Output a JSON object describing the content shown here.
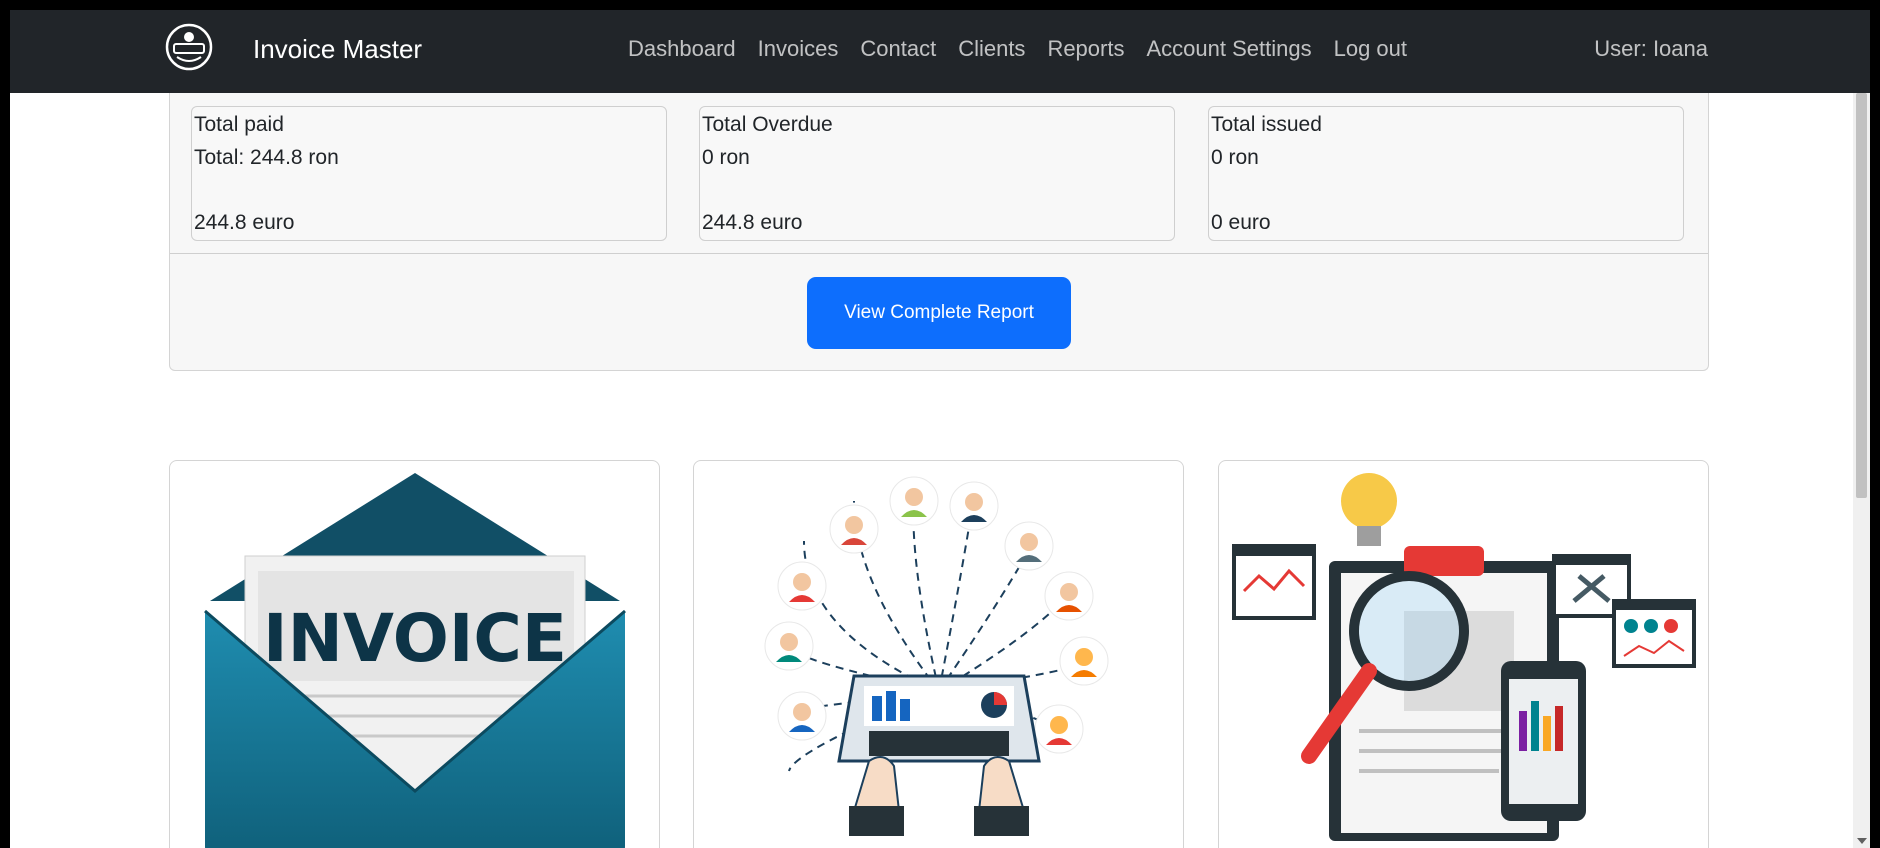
{
  "navbar": {
    "brand": "Invoice Master",
    "links": [
      "Dashboard",
      "Invoices",
      "Contact",
      "Clients",
      "Reports",
      "Account Settings",
      "Log out"
    ],
    "user": "User: Ioana"
  },
  "summary": {
    "paid": {
      "title": "Total paid",
      "line2": "Total: 244.8 ron",
      "line3": "244.8 euro"
    },
    "overdue": {
      "title": "Total Overdue",
      "line2": "0 ron",
      "line3": "244.8 euro"
    },
    "issued": {
      "title": "Total issued",
      "line2": "0 ron",
      "line3": "0 euro"
    },
    "button_label": "View Complete Report"
  },
  "cards": [
    {
      "image_text": "INVOICE",
      "icon": "invoice-envelope-illustration"
    },
    {
      "icon": "network-laptop-illustration"
    },
    {
      "icon": "analytics-report-illustration"
    }
  ],
  "colors": {
    "navbar": "#212529",
    "accent": "#0d6efd",
    "teal": "#17738f"
  }
}
